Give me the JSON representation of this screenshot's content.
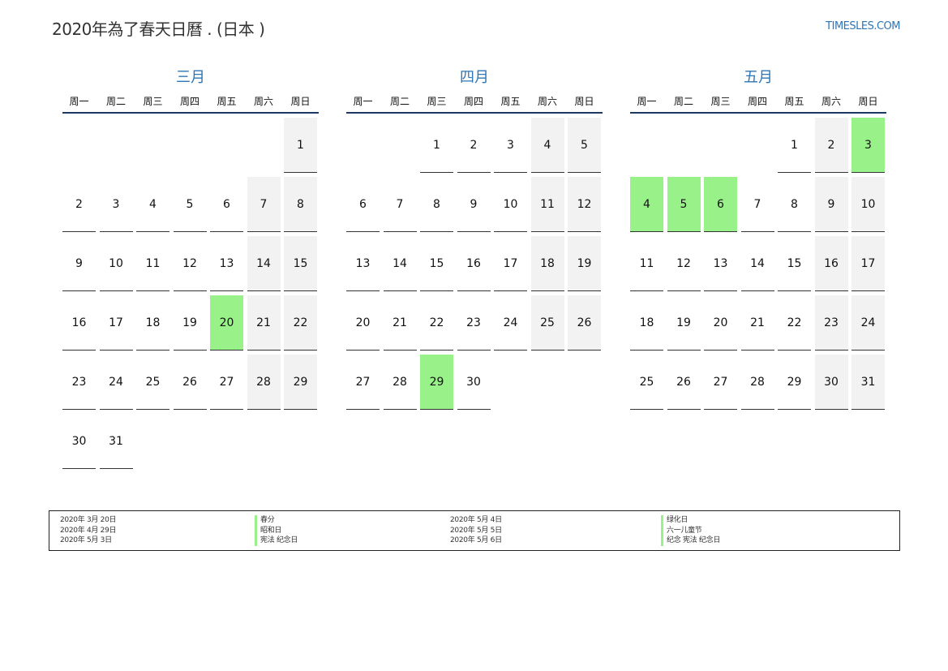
{
  "header": {
    "title": "2020年為了春天日曆 . (日本 )",
    "site": "TIMESLES.COM"
  },
  "colors": {
    "accent": "#2e75b6",
    "holiday": "#99f189",
    "weekend": "#f2f2f2",
    "rule": "#1f3864"
  },
  "weekdays": [
    "周一",
    "周二",
    "周三",
    "周四",
    "周五",
    "周六",
    "周日"
  ],
  "months": [
    {
      "title": "三月",
      "offset": 6,
      "days": [
        "1",
        "2",
        "3",
        "4",
        "5",
        "6",
        "7",
        "8",
        "9",
        "10",
        "11",
        "12",
        "13",
        "14",
        "15",
        "16",
        "17",
        "18",
        "19",
        "20",
        "21",
        "22",
        "23",
        "24",
        "25",
        "26",
        "27",
        "28",
        "29",
        "30",
        "31"
      ],
      "holidays": [
        "20"
      ]
    },
    {
      "title": "四月",
      "offset": 2,
      "days": [
        "1",
        "2",
        "3",
        "4",
        "5",
        "6",
        "7",
        "8",
        "9",
        "10",
        "11",
        "12",
        "13",
        "14",
        "15",
        "16",
        "17",
        "18",
        "19",
        "20",
        "21",
        "22",
        "23",
        "24",
        "25",
        "26",
        "27",
        "28",
        "29",
        "30"
      ],
      "holidays": [
        "29"
      ]
    },
    {
      "title": "五月",
      "offset": 4,
      "days": [
        "1",
        "2",
        "3",
        "4",
        "5",
        "6",
        "7",
        "8",
        "9",
        "10",
        "11",
        "12",
        "13",
        "14",
        "15",
        "16",
        "17",
        "18",
        "19",
        "20",
        "21",
        "22",
        "23",
        "24",
        "25",
        "26",
        "27",
        "28",
        "29",
        "30",
        "31"
      ],
      "holidays": [
        "3",
        "4",
        "5",
        "6"
      ]
    }
  ],
  "holiday_list": [
    {
      "date": "2020年 3月 20日",
      "name": "春分"
    },
    {
      "date": "2020年 4月 29日",
      "name": "昭和日"
    },
    {
      "date": "2020年 5月 3日",
      "name": "宪法 纪念日"
    },
    {
      "date": "2020年 5月 4日",
      "name": "绿化日"
    },
    {
      "date": "2020年 5月 5日",
      "name": "六一儿童节"
    },
    {
      "date": "2020年 5月 6日",
      "name": "纪念 宪法 纪念日"
    }
  ]
}
